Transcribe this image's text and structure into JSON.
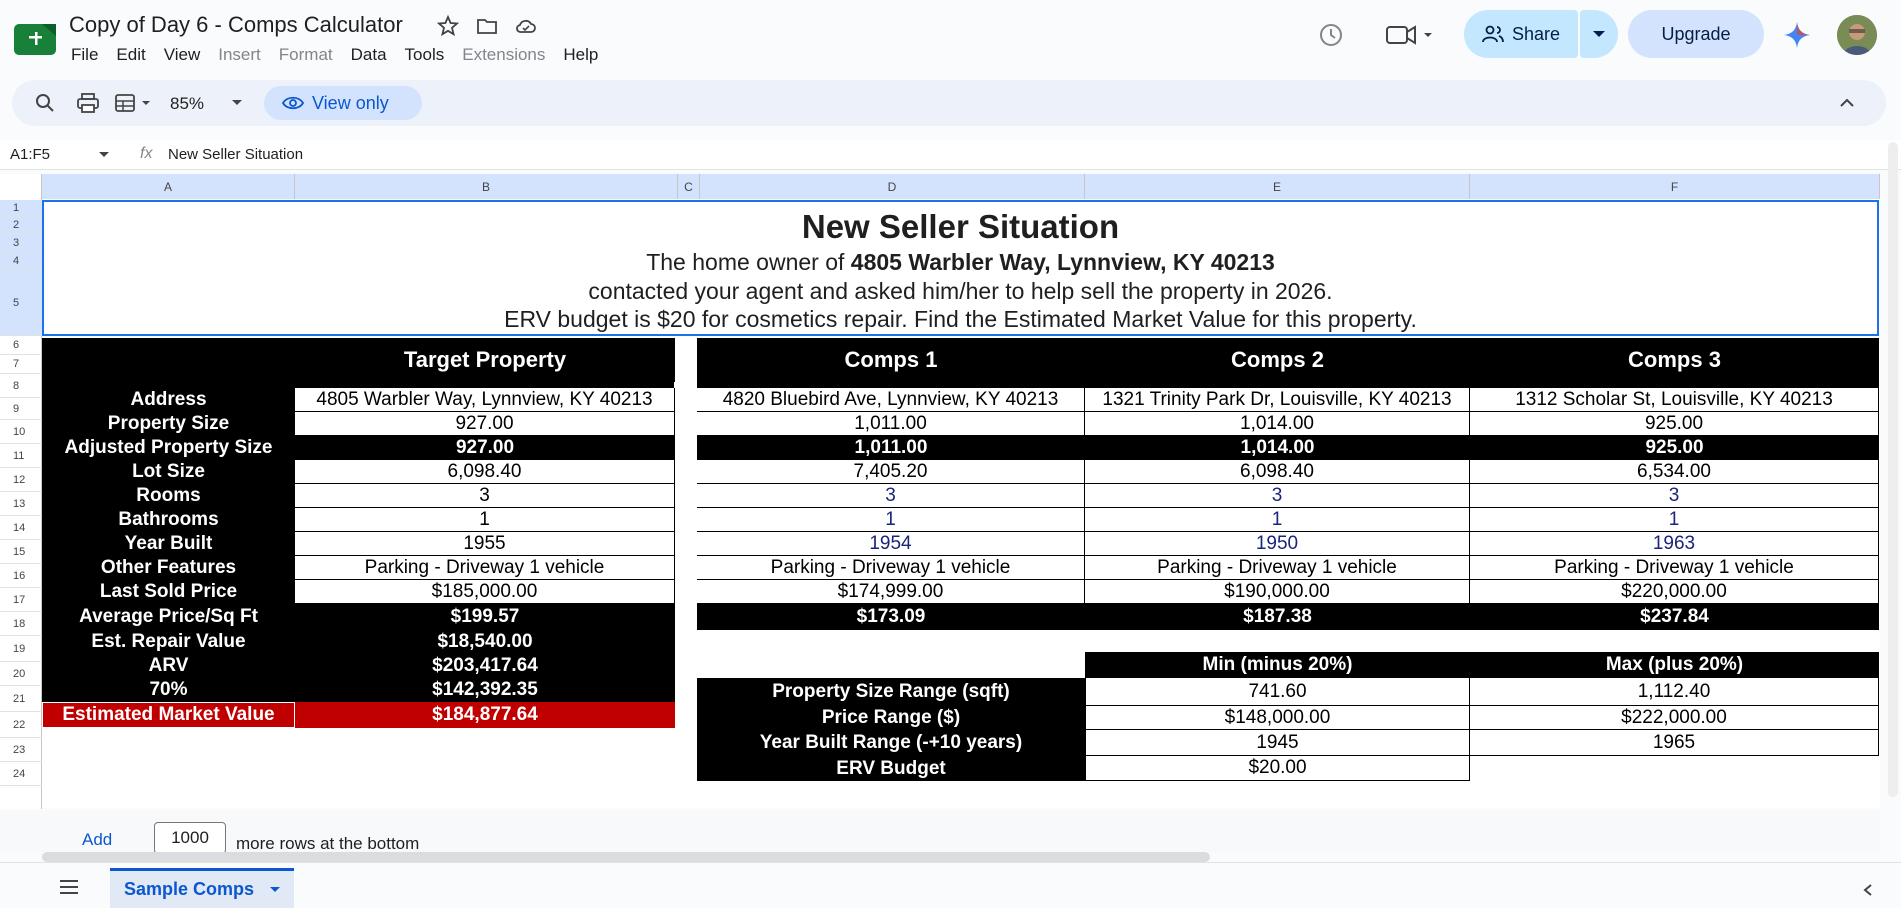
{
  "app": {
    "title": "Copy of Day 6 - Comps Calculator"
  },
  "menu": [
    "File",
    "Edit",
    "View",
    "Insert",
    "Format",
    "Data",
    "Tools",
    "Extensions",
    "Help"
  ],
  "menu_disabled": [
    "Insert",
    "Format",
    "Extensions"
  ],
  "header": {
    "share_label": "Share",
    "upgrade_label": "Upgrade"
  },
  "toolbar": {
    "zoom": "85%",
    "view_only": "View only"
  },
  "formula": {
    "name_box": "A1:F5",
    "fx": "fx",
    "content": "New Seller Situation"
  },
  "columns": [
    "A",
    "B",
    "C",
    "D",
    "E",
    "F"
  ],
  "rows": [
    "1",
    "2",
    "3",
    "4",
    "5",
    "6",
    "7",
    "8",
    "9",
    "10",
    "11",
    "12",
    "13",
    "14",
    "15",
    "16",
    "17",
    "18",
    "19",
    "20",
    "21",
    "22",
    "23",
    "24"
  ],
  "heading": {
    "title": "New Seller Situation",
    "line1_pre": "The home owner of ",
    "line1_bold": "4805 Warbler Way, Lynnview, KY 40213",
    "line2": "contacted your agent and asked him/her to help sell the property in 2026.",
    "line3": "ERV budget is $20 for cosmetics repair. Find the Estimated Market Value for this property."
  },
  "target": {
    "header": "Target Property",
    "labels": [
      "Address",
      "Property Size",
      "Adjusted Property Size",
      "Lot Size",
      "Rooms",
      "Bathrooms",
      "Year Built",
      "Other Features",
      "Last Sold Price",
      "Average Price/Sq Ft",
      "Est. Repair Value",
      "ARV",
      "70%",
      "Estimated Market Value"
    ],
    "values": [
      "4805 Warbler Way, Lynnview, KY 40213",
      "927.00",
      "927.00",
      "6,098.40",
      "3",
      "1",
      "1955",
      "Parking - Driveway 1 vehicle",
      "$185,000.00",
      "$199.57",
      "$18,540.00",
      "$203,417.64",
      "$142,392.35",
      "$184,877.64"
    ]
  },
  "comps": [
    {
      "header": "Comps 1",
      "values": [
        "4820 Bluebird Ave, Lynnview, KY 40213",
        "1,011.00",
        "1,011.00",
        "7,405.20",
        "3",
        "1",
        "1954",
        "Parking - Driveway 1 vehicle",
        "$174,999.00",
        "$173.09"
      ]
    },
    {
      "header": "Comps 2",
      "values": [
        "1321 Trinity Park Dr, Louisville, KY 40213",
        "1,014.00",
        "1,014.00",
        "6,098.40",
        "3",
        "1",
        "1950",
        "Parking - Driveway 1 vehicle",
        "$190,000.00",
        "$187.38"
      ]
    },
    {
      "header": "Comps 3",
      "values": [
        "1312 Scholar St, Louisville, KY 40213",
        "925.00",
        "925.00",
        "6,534.00",
        "3",
        "1",
        "1963",
        "Parking - Driveway 1 vehicle",
        "$220,000.00",
        "$237.84"
      ]
    }
  ],
  "ranges": {
    "min_header": "Min (minus 20%)",
    "max_header": "Max (plus 20%)",
    "labels": [
      "Property Size Range (sqft)",
      "Price Range ($)",
      "Year Built Range (-+10 years)",
      "ERV Budget"
    ],
    "min": [
      "741.60",
      "$148,000.00",
      "1945",
      "$20.00"
    ],
    "max": [
      "1,112.40",
      "$222,000.00",
      "1965"
    ]
  },
  "footer": {
    "add_label": "Add",
    "add_count": "1000",
    "add_suffix": "more rows at the bottom",
    "sheet_tab": "Sample Comps"
  },
  "colors": {
    "accent": "#0b57d0",
    "red_cell": "#c00000",
    "share_bg": "#c2e7ff"
  }
}
